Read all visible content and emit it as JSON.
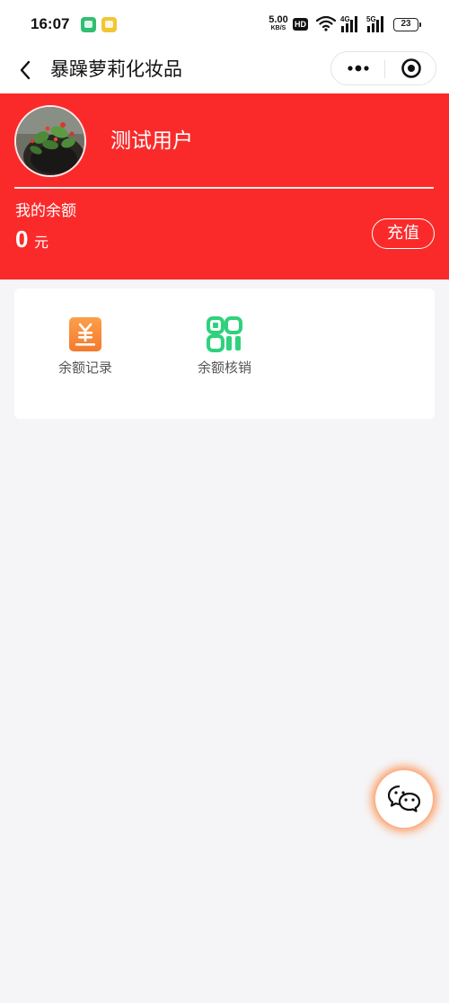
{
  "status_bar": {
    "time": "16:07",
    "net_speed_value": "5.00",
    "net_speed_unit": "KB/S",
    "hd_label": "HD",
    "signal_a_label": "4G",
    "signal_b_label": "5G",
    "battery": "23",
    "notification_icons": [
      "message-icon",
      "vpn-icon"
    ]
  },
  "nav": {
    "title": "暴躁萝莉化妆品",
    "back_icon": "chevron-left-icon",
    "more_icon": "more-dots-icon",
    "close_icon": "target-circle-icon"
  },
  "profile": {
    "username": "测试用户",
    "balance_label": "我的余额",
    "balance_value": "0",
    "balance_unit": "元",
    "recharge_label": "充值"
  },
  "menu": {
    "items": [
      {
        "label": "余额记录",
        "icon": "yuan-document-icon",
        "color": "#f5883a"
      },
      {
        "label": "余额核销",
        "icon": "qr-code-icon",
        "color": "#2ed27c"
      }
    ]
  },
  "floating": {
    "icon": "wechat-chat-icon"
  },
  "colors": {
    "brand_red": "#fb2a2a",
    "background": "#f5f5f7"
  }
}
